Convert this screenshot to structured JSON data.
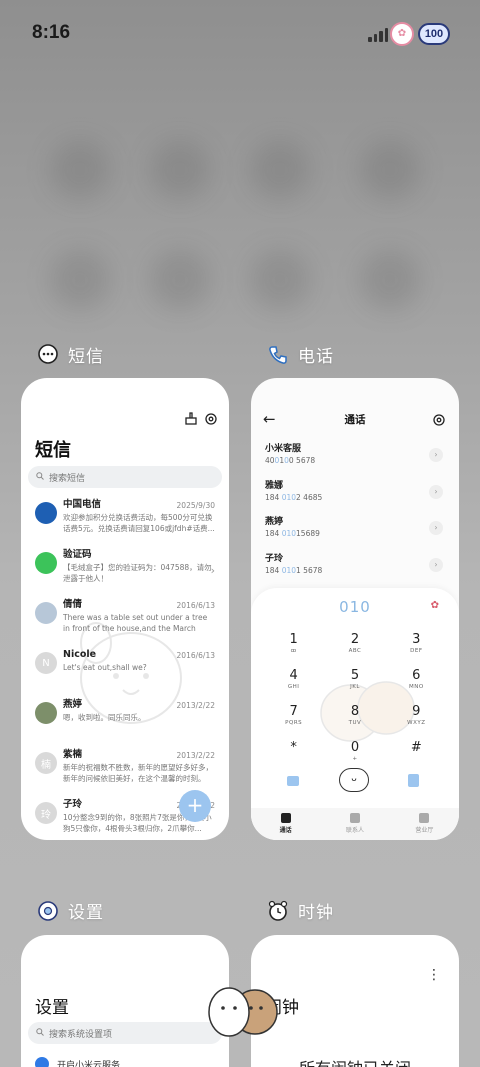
{
  "status_bar": {
    "time": "8:16",
    "battery": "100"
  },
  "cards": {
    "sms": {
      "header_label": "短信",
      "title": "短信",
      "search_placeholder": "搜索短信",
      "messages": [
        {
          "name": "中国电信",
          "date": "2025/9/30",
          "preview": "欢迎参加积分兑换话费活动，每500分可兑换话费5元。兑换话费请回复106或jfdh#话费...",
          "avatar_color": "#1e5fb3",
          "avatar_text": ""
        },
        {
          "name": "验证码",
          "date": "",
          "preview": "【毛绒盒子】您的验证码为：047588，请勿泄露于他人！",
          "avatar_color": "#3cc35a",
          "avatar_text": ""
        },
        {
          "name": "倩倩",
          "date": "2016/6/13",
          "preview": "There was a table set out under a tree in front of the house,and the March Hare an...",
          "avatar_color": "#b7c7d8",
          "avatar_text": ""
        },
        {
          "name": "Nicole",
          "date": "2016/6/13",
          "preview": "Let's eat out,shall we?",
          "avatar_color": "#d9d9d9",
          "avatar_text": "N"
        },
        {
          "name": "燕婷",
          "date": "2013/2/22",
          "preview": "嗯，收到啦。同乐同乐。",
          "avatar_color": "#7d8f6a",
          "avatar_text": ""
        },
        {
          "name": "紫楠",
          "date": "2013/2/22",
          "preview": "新年的祝福数不胜数，新年的愿望好多好多，新年的问候依旧美好，在这个温馨的时刻。",
          "avatar_color": "#d9d9d9",
          "avatar_text": "楠"
        },
        {
          "name": "子玲",
          "date": "2013/2/22",
          "preview": "10分整念9到的你，8张照片7张是你，6只小狗5只像你，4根骨头3根归你，2爪攀你...",
          "avatar_color": "#d9d9d9",
          "avatar_text": "玲"
        }
      ],
      "fab": "+"
    },
    "phone": {
      "header_label": "电话",
      "title": "通话",
      "calls": [
        {
          "name": "小米客服",
          "num_pre": "40",
          "num_hl": "0",
          "num_mid": "1",
          "num_hl2": "0",
          "num_post": "0 5678"
        },
        {
          "name": "雅娜",
          "num_pre": "184 ",
          "num_hl": "010",
          "num_mid": "2 4685",
          "num_hl2": "",
          "num_post": ""
        },
        {
          "name": "燕婷",
          "num_pre": "184 ",
          "num_hl": "010",
          "num_mid": "15689",
          "num_hl2": "",
          "num_post": ""
        },
        {
          "name": "子玲",
          "num_pre": "184 ",
          "num_hl": "010",
          "num_mid": "1 5678",
          "num_hl2": "",
          "num_post": ""
        }
      ],
      "dial_input": "010",
      "keys": [
        {
          "d": "1",
          "l": "ꝏ"
        },
        {
          "d": "2",
          "l": "ABC"
        },
        {
          "d": "3",
          "l": "DEF"
        },
        {
          "d": "4",
          "l": "GHI"
        },
        {
          "d": "5",
          "l": "JKL"
        },
        {
          "d": "6",
          "l": "MNO"
        },
        {
          "d": "7",
          "l": "PQRS"
        },
        {
          "d": "8",
          "l": "TUV"
        },
        {
          "d": "9",
          "l": "WXYZ"
        },
        {
          "d": "*",
          "l": ""
        },
        {
          "d": "0",
          "l": "+"
        },
        {
          "d": "#",
          "l": ""
        }
      ],
      "tabs": [
        "通话",
        "联系人",
        "营业厅"
      ]
    },
    "settings": {
      "header_label": "设置",
      "title": "设置",
      "search_placeholder": "搜索系统设置项",
      "first_row": "开启小米云服务"
    },
    "clock": {
      "header_label": "时钟",
      "title": "闹钟",
      "empty_text": "所有闹钟已关闭"
    }
  },
  "colors": {
    "accent": "#9cc5ef",
    "highlight": "#8fb8e4"
  }
}
